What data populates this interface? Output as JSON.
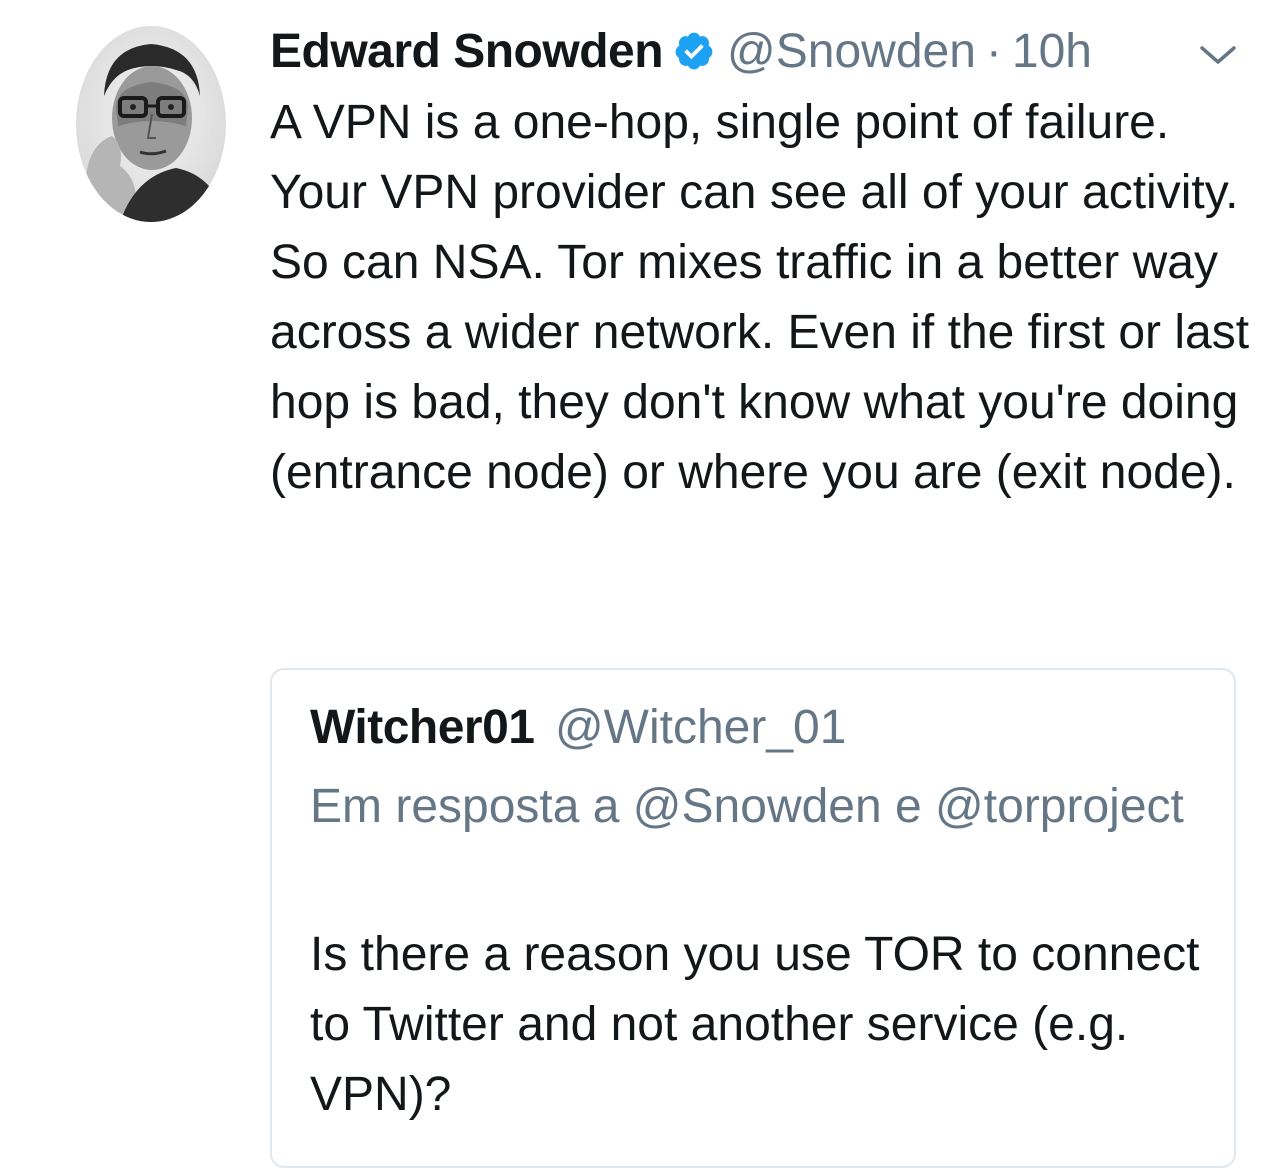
{
  "tweet": {
    "author_name": "Edward Snowden",
    "verified_icon": "verified-badge-icon",
    "handle": "@Snowden",
    "separator": "·",
    "time": "10h",
    "menu_icon": "chevron-down-icon",
    "text": "A VPN is a one-hop, single point of failure. Your VPN provider can see all of your activity. So can NSA. Tor mixes traffic in a better way across a wider network. Even if the first or last hop is bad, they don't know what you're doing (entrance node) or where you are (exit node)."
  },
  "quoted_tweet": {
    "author_name": "Witcher01",
    "handle": "@Witcher_01",
    "reply_context": "Em resposta a @Snowden e @torproject",
    "text": "Is there a reason you use TOR to connect to Twitter and not another service (e.g. VPN)?"
  },
  "colors": {
    "text_primary": "#14171a",
    "text_secondary": "#657786",
    "verified_blue": "#1da1f2",
    "border": "#e1e8ed"
  }
}
